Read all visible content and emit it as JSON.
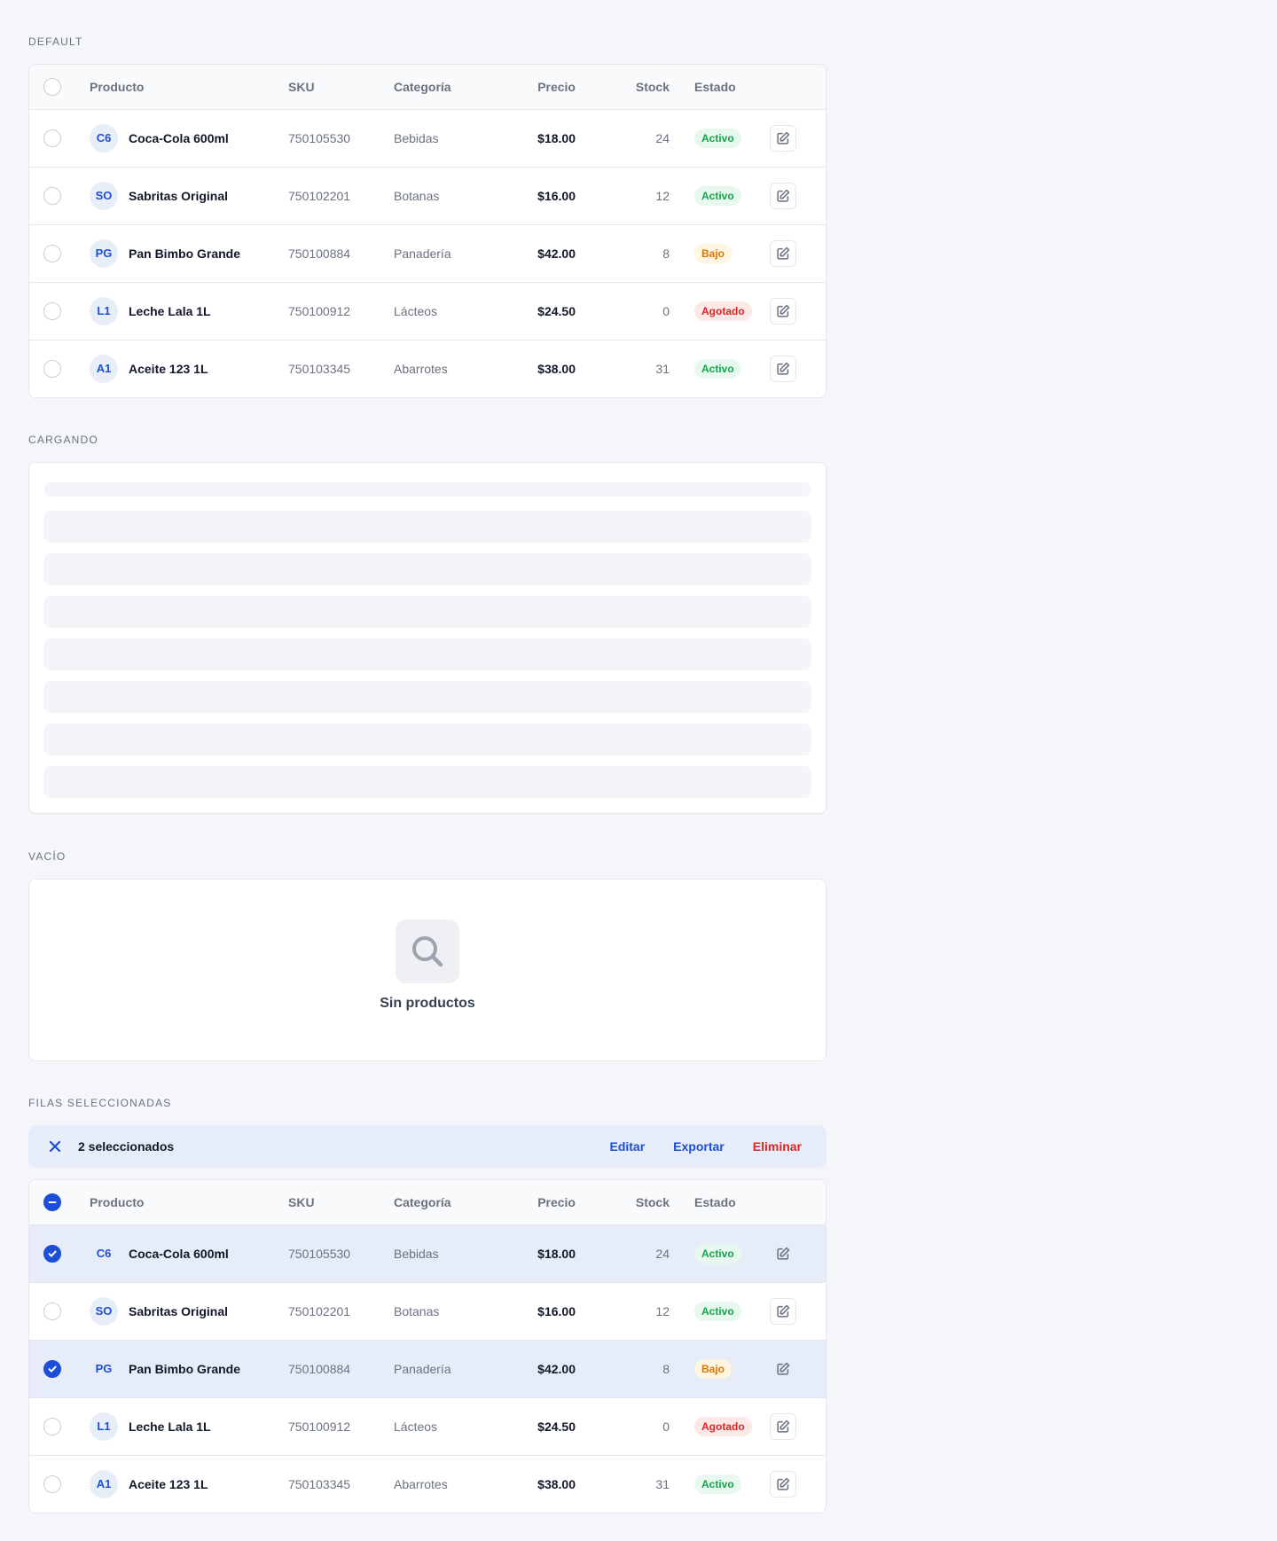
{
  "sections": {
    "default": "DEFAULT",
    "loading": "CARGANDO",
    "empty": "VACÍO",
    "selected": "FILAS SELECCIONADAS"
  },
  "columns": {
    "product": "Producto",
    "sku": "SKU",
    "category": "Categoría",
    "price": "Precio",
    "stock": "Stock",
    "state": "Estado"
  },
  "rows": [
    {
      "initials": "C6",
      "name": "Coca-Cola 600ml",
      "sku": "750105530",
      "category": "Bebidas",
      "price": "$18.00",
      "stock": "24",
      "state": "Activo",
      "state_kind": "ok"
    },
    {
      "initials": "SO",
      "name": "Sabritas Original",
      "sku": "750102201",
      "category": "Botanas",
      "price": "$16.00",
      "stock": "12",
      "state": "Activo",
      "state_kind": "ok"
    },
    {
      "initials": "PG",
      "name": "Pan Bimbo Grande",
      "sku": "750100884",
      "category": "Panadería",
      "price": "$42.00",
      "stock": "8",
      "state": "Bajo",
      "state_kind": "low"
    },
    {
      "initials": "L1",
      "name": "Leche Lala 1L",
      "sku": "750100912",
      "category": "Lácteos",
      "price": "$24.50",
      "stock": "0",
      "state": "Agotado",
      "state_kind": "out"
    },
    {
      "initials": "A1",
      "name": "Aceite 123 1L",
      "sku": "750103345",
      "category": "Abarrotes",
      "price": "$38.00",
      "stock": "31",
      "state": "Activo",
      "state_kind": "ok"
    }
  ],
  "selected_rows": [
    0,
    2
  ],
  "empty": {
    "icon": "search-icon",
    "text": "Sin productos"
  },
  "bulk": {
    "count_label": "2 seleccionados",
    "edit": "Editar",
    "export": "Exportar",
    "delete": "Eliminar"
  },
  "colors": {
    "accent": "#1d4ed8",
    "danger": "#dc2626",
    "success": "#16a34a",
    "warning": "#d97706",
    "background": "#f4f6fa"
  }
}
